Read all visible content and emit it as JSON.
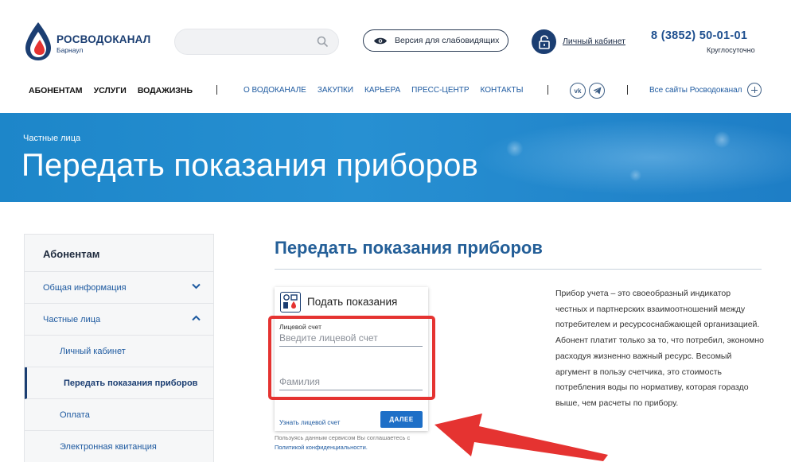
{
  "header": {
    "logo_name": "РОСВОДОКАНАЛ",
    "logo_city": "Барнаул",
    "search_placeholder": "",
    "accessibility_label": "Версия для слабовидящих",
    "cabinet_label": "Личный кабинет",
    "phone": "8 (3852) 50-01-01",
    "hours": "Круглосуточно"
  },
  "nav": {
    "main": [
      "АБОНЕНТАМ",
      "УСЛУГИ",
      "ВОДАЖИЗНЬ"
    ],
    "secondary": [
      "О ВОДОКАНАЛЕ",
      "ЗАКУПКИ",
      "КАРЬЕРА",
      "ПРЕСС-ЦЕНТР",
      "КОНТАКТЫ"
    ],
    "social": [
      "vk",
      "tg"
    ],
    "all_sites": "Все сайты Росводоканал"
  },
  "banner": {
    "breadcrumb": "Частные лица",
    "title": "Передать показания приборов"
  },
  "sidebar": {
    "heading": "Абонентам",
    "items": [
      {
        "label": "Общая информация"
      },
      {
        "label": "Частные лица"
      },
      {
        "label": "Личный кабинет"
      },
      {
        "label": "Передать показания приборов"
      },
      {
        "label": "Оплата"
      },
      {
        "label": "Электронная квитанция"
      }
    ]
  },
  "main": {
    "title": "Передать показания приборов",
    "form": {
      "heading": "Подать показания",
      "account_label": "Лицевой счет",
      "account_placeholder": "Введите лицевой счет",
      "surname_placeholder": "Фамилия",
      "forgot_link": "Узнать лицевой счет",
      "next_button": "ДАЛЕЕ"
    },
    "consent_text": "Пользуясь данным сервисом Вы соглашаетесь с",
    "consent_link": "Политикой конфиденциальности.",
    "description": "Прибор учета – это своеобразный индикатор честных и партнерских взаимоотношений между потребителем и ресурсоснабжающей организацией. Абонент платит только за то, что потребил, экономно расходуя жизненно важный ресурс. Весомый аргумент в пользу счетчика, это стоимость потребления воды по нормативу, которая гораздо выше, чем расчеты по прибору."
  },
  "colors": {
    "brand_blue": "#1b3e72",
    "link_blue": "#1e5aa0",
    "banner_blue": "#2790d2",
    "highlight_red": "#e53331"
  }
}
